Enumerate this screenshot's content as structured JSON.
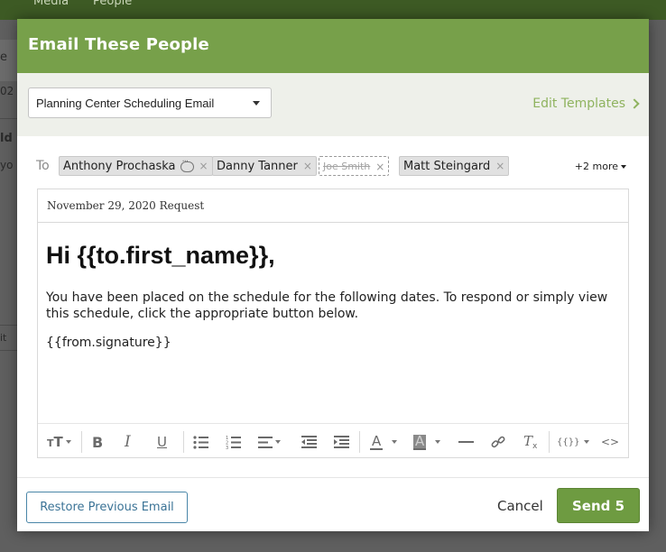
{
  "background": {
    "tabs": [
      "Media",
      "People"
    ],
    "fragments": [
      "e",
      "02",
      "ld",
      "yo",
      "it"
    ]
  },
  "modal": {
    "title": "Email These People",
    "template_select": "Planning Center Scheduling Email",
    "edit_templates": "Edit Templates",
    "to_label": "To",
    "recipients": [
      {
        "name": "Anthony Prochaska",
        "removed": false,
        "has_note": true
      },
      {
        "name": "Danny Tanner",
        "removed": false,
        "has_note": false
      },
      {
        "name": "Joe Smith",
        "removed": true,
        "has_note": false
      },
      {
        "name": "Matt Steingard",
        "removed": false,
        "has_note": false
      }
    ],
    "remove_glyph": "×",
    "more_recipients": "+2 more",
    "subject": "November 29, 2020 Request",
    "body": {
      "greeting": "Hi {{to.first_name}},",
      "paragraph": "You have been placed on the schedule for the following dates. To respond or simply view this schedule, click the appropriate button below.",
      "signature": "{{from.signature}}"
    },
    "toolbar": {
      "font_size": "TT",
      "bold": "B",
      "italic": "I",
      "underline": "U",
      "text_color": "A",
      "bg_color": "A",
      "template_vars": "{{}}",
      "code": "<>",
      "clear_format": "Tx"
    },
    "footer": {
      "restore": "Restore Previous Email",
      "cancel": "Cancel",
      "send": "Send 5"
    },
    "colors": {
      "header": "#77a04a",
      "primary": "#6e9b41",
      "link": "#8fb35f",
      "restore_border": "#4a86a8"
    }
  }
}
